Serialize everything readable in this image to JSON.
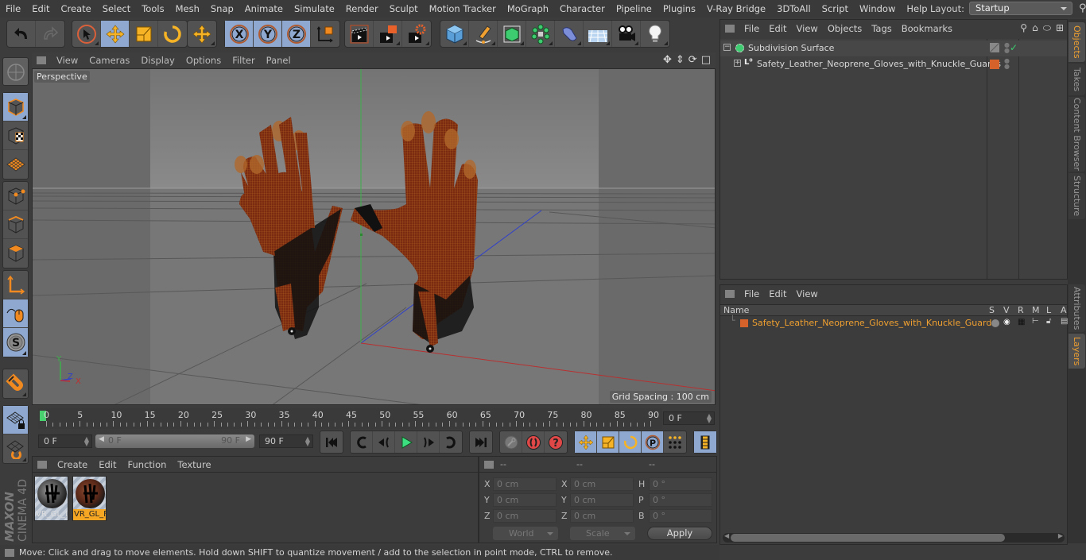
{
  "menubar": {
    "items": [
      "File",
      "Edit",
      "Create",
      "Select",
      "Tools",
      "Mesh",
      "Snap",
      "Animate",
      "Simulate",
      "Render",
      "Sculpt",
      "Motion Tracker",
      "MoGraph",
      "Character",
      "Pipeline",
      "Plugins",
      "V-Ray Bridge",
      "3DToAll",
      "Script",
      "Window",
      "Help"
    ],
    "layout_label": "Layout:",
    "layout_value": "Startup"
  },
  "toolbar": {
    "groups": [
      [
        "undo-icon",
        "redo-icon"
      ],
      [
        "live-selection-icon",
        "move-icon",
        "scale-icon",
        "rotate-icon"
      ],
      [
        "recent-tool-icon"
      ],
      [
        "x-axis-lock-icon",
        "y-axis-lock-icon",
        "z-axis-lock-icon",
        "coordinate-system-icon"
      ],
      [
        "render-view-icon",
        "render-picture-viewer-icon",
        "render-settings-icon"
      ],
      [
        "cube-icon",
        "pen-spline-icon",
        "subdivision-icon",
        "cloner-icon",
        "deformer-icon",
        "floor-icon",
        "camera-icon",
        "light-icon"
      ]
    ]
  },
  "left_toolbar": {
    "items": [
      "make-editable-icon",
      "texture-mode-icon",
      "workplane-icon",
      "points-mode-icon",
      "edges-mode-icon",
      "polygons-mode-icon",
      "axis-mode-icon",
      "tweak-mode-icon",
      "solo-icon",
      "snap-magnet-icon",
      "lock-workplane-icon",
      "workplane-snap-icon"
    ]
  },
  "viewport": {
    "menu": [
      "View",
      "Cameras",
      "Display",
      "Options",
      "Filter",
      "Panel"
    ],
    "camera_label": "Perspective",
    "grid_spacing": "Grid Spacing : 100 cm",
    "axis_labels": {
      "x": "X",
      "y": "Y",
      "z": "Z"
    }
  },
  "timeline": {
    "ticks": [
      "0",
      "5",
      "10",
      "15",
      "20",
      "25",
      "30",
      "35",
      "40",
      "45",
      "50",
      "55",
      "60",
      "65",
      "70",
      "75",
      "80",
      "85",
      "90"
    ],
    "current_frame": "0 F",
    "start_frame": "0 F",
    "range_start": "0 F",
    "range_end": "90 F",
    "end_frame": "90 F"
  },
  "materials": {
    "menu": [
      "Create",
      "Edit",
      "Function",
      "Texture"
    ],
    "items": [
      {
        "name": "VR_GL_L",
        "selected": false
      },
      {
        "name": "VR_GL_F",
        "selected": true
      }
    ]
  },
  "coordinates": {
    "headers": [
      "--",
      "--",
      "--"
    ],
    "rows": [
      {
        "l1": "X",
        "v1": "0 cm",
        "l2": "X",
        "v2": "0 cm",
        "l3": "H",
        "v3": "0 °"
      },
      {
        "l1": "Y",
        "v1": "0 cm",
        "l2": "Y",
        "v2": "0 cm",
        "l3": "P",
        "v3": "0 °"
      },
      {
        "l1": "Z",
        "v1": "0 cm",
        "l2": "Z",
        "v2": "0 cm",
        "l3": "B",
        "v3": "0 °"
      }
    ],
    "mode": "World",
    "size_mode": "Scale",
    "apply_label": "Apply"
  },
  "status": {
    "text": "Move: Click and drag to move elements. Hold down SHIFT to quantize movement / add to the selection in point mode, CTRL to remove."
  },
  "logo": {
    "brand": "MAXON",
    "product": "CINEMA 4D"
  },
  "object_manager": {
    "menu": [
      "File",
      "Edit",
      "View",
      "Objects",
      "Tags",
      "Bookmarks"
    ],
    "objects": [
      {
        "name": "Subdivision Surface",
        "icon": "subdivision-icon",
        "expanded": true
      },
      {
        "name": "Safety_Leather_Neoprene_Gloves_with_Knuckle_Guards",
        "icon": "null-object-icon",
        "expanded": false,
        "layer_color": "#d4622a"
      }
    ]
  },
  "right_tabs": {
    "top": [
      {
        "label": "Objects",
        "active": true
      },
      {
        "label": "Takes",
        "active": false
      },
      {
        "label": "Content Browser",
        "active": false
      },
      {
        "label": "Structure",
        "active": false
      }
    ],
    "bottom": [
      {
        "label": "Attributes",
        "active": false
      },
      {
        "label": "Layers",
        "active": true
      }
    ]
  },
  "layer_manager": {
    "menu": [
      "File",
      "Edit",
      "View"
    ],
    "columns": [
      "Name",
      "S",
      "V",
      "R",
      "M",
      "L",
      "A"
    ],
    "layers": [
      {
        "name": "Safety_Leather_Neoprene_Gloves_with_Knuckle_Guards",
        "color": "#d4622a"
      }
    ]
  },
  "colors": {
    "accent": "#f0a030",
    "selection_blue": "#8ea8cf",
    "playhead": "#48d06e",
    "layer_orange": "#d4622a"
  }
}
